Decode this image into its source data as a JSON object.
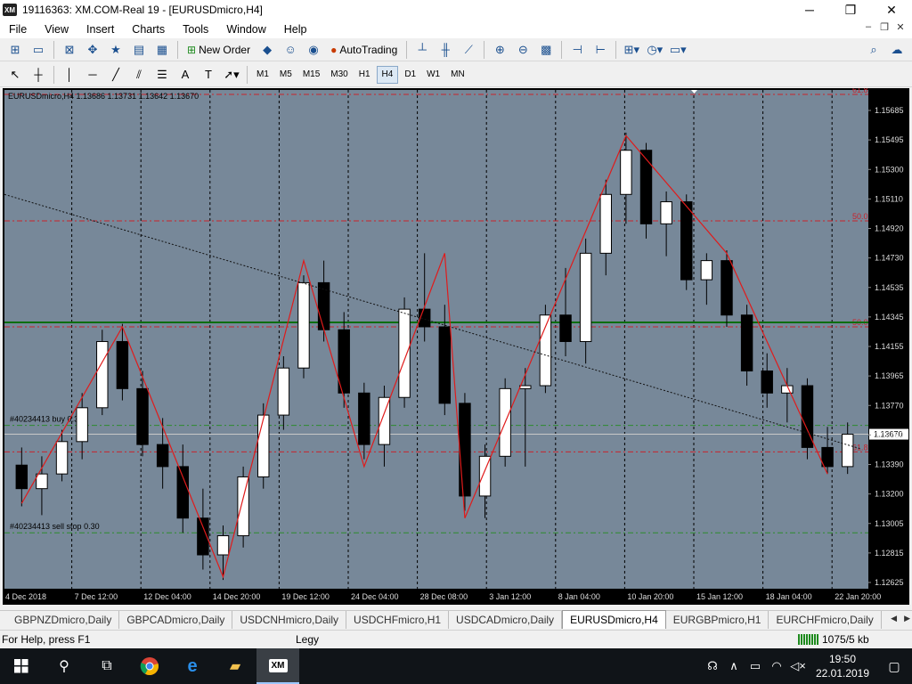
{
  "window": {
    "title": "19116363: XM.COM-Real 19 - [EURUSDmicro,H4]",
    "logo_text": "XM",
    "minimize": "─",
    "maximize": "❐",
    "close": "✕"
  },
  "menu": {
    "items": [
      "File",
      "View",
      "Insert",
      "Charts",
      "Tools",
      "Window",
      "Help"
    ],
    "mdi_min": "–",
    "mdi_restore": "❐",
    "mdi_close": "✕"
  },
  "toolbar": {
    "new_order": "New Order",
    "auto_trading": "AutoTrading"
  },
  "timeframes": [
    "M1",
    "M5",
    "M15",
    "M30",
    "H1",
    "H4",
    "D1",
    "W1",
    "MN"
  ],
  "active_timeframe": "H4",
  "chart_data": {
    "type": "candlestick",
    "symbol_header": "EURUSDmicro,H4  1.13686 1.13731 1.13642 1.13670",
    "x_tick_labels": [
      "4 Dec 2018",
      "7 Dec 12:00",
      "12 Dec 04:00",
      "14 Dec 20:00",
      "19 Dec 12:00",
      "24 Dec 04:00",
      "28 Dec 08:00",
      "3 Jan 12:00",
      "8 Jan 04:00",
      "10 Jan 20:00",
      "15 Jan 12:00",
      "18 Jan 04:00",
      "22 Jan 20:00"
    ],
    "y_tick_labels": [
      "1.15685",
      "1.15495",
      "1.15300",
      "1.15110",
      "1.14920",
      "1.14730",
      "1.14535",
      "1.14345",
      "1.14155",
      "1.13965",
      "1.13770",
      "1.13580",
      "1.13390",
      "1.13200",
      "1.13005",
      "1.12815",
      "1.12625"
    ],
    "ylim": [
      1.1262,
      1.1601
    ],
    "current_price": "1.13670",
    "background_color": "#778899",
    "zigzag_points": [
      {
        "date": "4 Dec 2018",
        "price": 1.132
      },
      {
        "date": "7 Dec 2018",
        "price": 1.144
      },
      {
        "date": "13 Dec 2018",
        "price": 1.127
      },
      {
        "date": "19 Dec 2018",
        "price": 1.1485
      },
      {
        "date": "24 Dec 2018",
        "price": 1.1345
      },
      {
        "date": "28 Dec 2018",
        "price": 1.149
      },
      {
        "date": "2 Jan 2019",
        "price": 1.131
      },
      {
        "date": "9 Jan 2019",
        "price": 1.157
      },
      {
        "date": "14 Jan 2019",
        "price": 1.149
      },
      {
        "date": "22 Jan 2019",
        "price": 1.134
      }
    ],
    "fib_levels": [
      {
        "label": "61.8",
        "price": 1.1598
      },
      {
        "label": "50.0",
        "price": 1.1512
      },
      {
        "label": "50.0",
        "price": 1.144
      },
      {
        "label": "61.8",
        "price": 1.1355
      }
    ],
    "horizontal_lines": [
      {
        "type": "support-resistance",
        "price": 1.1443,
        "color": "#0a6e0a"
      },
      {
        "type": "buy-order",
        "price": 1.1373,
        "label": "#40234413 buy 0.30",
        "color": "#2e8b2e"
      },
      {
        "type": "sell-stop",
        "price": 1.13,
        "label": "#40234413 sell stop 0.30",
        "color": "#2e8b2e"
      }
    ],
    "trendline": {
      "from_date": "4 Dec 2018",
      "from_price": 1.153,
      "to_date": "22 Jan 2019",
      "to_price": 1.1357
    },
    "candles": [
      {
        "o": 1.1346,
        "h": 1.1358,
        "l": 1.1318,
        "c": 1.133
      },
      {
        "o": 1.133,
        "h": 1.1352,
        "l": 1.1312,
        "c": 1.134
      },
      {
        "o": 1.134,
        "h": 1.137,
        "l": 1.1335,
        "c": 1.1362
      },
      {
        "o": 1.1362,
        "h": 1.1395,
        "l": 1.135,
        "c": 1.1385
      },
      {
        "o": 1.1385,
        "h": 1.1438,
        "l": 1.138,
        "c": 1.143
      },
      {
        "o": 1.143,
        "h": 1.1442,
        "l": 1.139,
        "c": 1.1398
      },
      {
        "o": 1.1398,
        "h": 1.141,
        "l": 1.1352,
        "c": 1.136
      },
      {
        "o": 1.136,
        "h": 1.1378,
        "l": 1.133,
        "c": 1.1345
      },
      {
        "o": 1.1345,
        "h": 1.136,
        "l": 1.13,
        "c": 1.131
      },
      {
        "o": 1.131,
        "h": 1.133,
        "l": 1.1275,
        "c": 1.1285
      },
      {
        "o": 1.1285,
        "h": 1.1305,
        "l": 1.1268,
        "c": 1.1298
      },
      {
        "o": 1.1298,
        "h": 1.1345,
        "l": 1.129,
        "c": 1.1338
      },
      {
        "o": 1.1338,
        "h": 1.1388,
        "l": 1.133,
        "c": 1.138
      },
      {
        "o": 1.138,
        "h": 1.142,
        "l": 1.137,
        "c": 1.1412
      },
      {
        "o": 1.1412,
        "h": 1.1475,
        "l": 1.1405,
        "c": 1.147
      },
      {
        "o": 1.147,
        "h": 1.1485,
        "l": 1.143,
        "c": 1.1438
      },
      {
        "o": 1.1438,
        "h": 1.145,
        "l": 1.1385,
        "c": 1.1395
      },
      {
        "o": 1.1395,
        "h": 1.1402,
        "l": 1.135,
        "c": 1.136
      },
      {
        "o": 1.136,
        "h": 1.14,
        "l": 1.1345,
        "c": 1.1392
      },
      {
        "o": 1.1392,
        "h": 1.146,
        "l": 1.1385,
        "c": 1.1452
      },
      {
        "o": 1.1452,
        "h": 1.149,
        "l": 1.143,
        "c": 1.144
      },
      {
        "o": 1.144,
        "h": 1.1455,
        "l": 1.138,
        "c": 1.1388
      },
      {
        "o": 1.1388,
        "h": 1.1395,
        "l": 1.1315,
        "c": 1.1325
      },
      {
        "o": 1.1325,
        "h": 1.136,
        "l": 1.131,
        "c": 1.1352
      },
      {
        "o": 1.1352,
        "h": 1.1405,
        "l": 1.1345,
        "c": 1.1398
      },
      {
        "o": 1.1398,
        "h": 1.1412,
        "l": 1.1345,
        "c": 1.14
      },
      {
        "o": 1.14,
        "h": 1.1455,
        "l": 1.1395,
        "c": 1.1448
      },
      {
        "o": 1.1448,
        "h": 1.148,
        "l": 1.142,
        "c": 1.143
      },
      {
        "o": 1.143,
        "h": 1.15,
        "l": 1.1415,
        "c": 1.149
      },
      {
        "o": 1.149,
        "h": 1.154,
        "l": 1.1475,
        "c": 1.153
      },
      {
        "o": 1.153,
        "h": 1.1572,
        "l": 1.151,
        "c": 1.156
      },
      {
        "o": 1.156,
        "h": 1.1565,
        "l": 1.15,
        "c": 1.151
      },
      {
        "o": 1.151,
        "h": 1.1532,
        "l": 1.1488,
        "c": 1.1525
      },
      {
        "o": 1.1525,
        "h": 1.153,
        "l": 1.1465,
        "c": 1.1472
      },
      {
        "o": 1.1472,
        "h": 1.149,
        "l": 1.1455,
        "c": 1.1485
      },
      {
        "o": 1.1485,
        "h": 1.1492,
        "l": 1.144,
        "c": 1.1448
      },
      {
        "o": 1.1448,
        "h": 1.1455,
        "l": 1.14,
        "c": 1.141
      },
      {
        "o": 1.141,
        "h": 1.1422,
        "l": 1.1385,
        "c": 1.1395
      },
      {
        "o": 1.1395,
        "h": 1.1412,
        "l": 1.1375,
        "c": 1.14
      },
      {
        "o": 1.14,
        "h": 1.1405,
        "l": 1.135,
        "c": 1.1358
      },
      {
        "o": 1.1358,
        "h": 1.1372,
        "l": 1.134,
        "c": 1.1345
      },
      {
        "o": 1.1345,
        "h": 1.1375,
        "l": 1.134,
        "c": 1.1367
      }
    ]
  },
  "chart_tabs": [
    "GBPNZDmicro,Daily",
    "GBPCADmicro,Daily",
    "USDCNHmicro,Daily",
    "USDCHFmicro,H1",
    "USDCADmicro,Daily",
    "EURUSDmicro,H4",
    "EURGBPmicro,H1",
    "EURCHFmicro,Daily"
  ],
  "active_tab": "EURUSDmicro,H4",
  "status": {
    "help": "For Help, press F1",
    "profile": "Legy",
    "traffic": "1075/5 kb"
  },
  "taskbar": {
    "time": "19:50",
    "date": "22.01.2019",
    "xm_label": "XM"
  }
}
